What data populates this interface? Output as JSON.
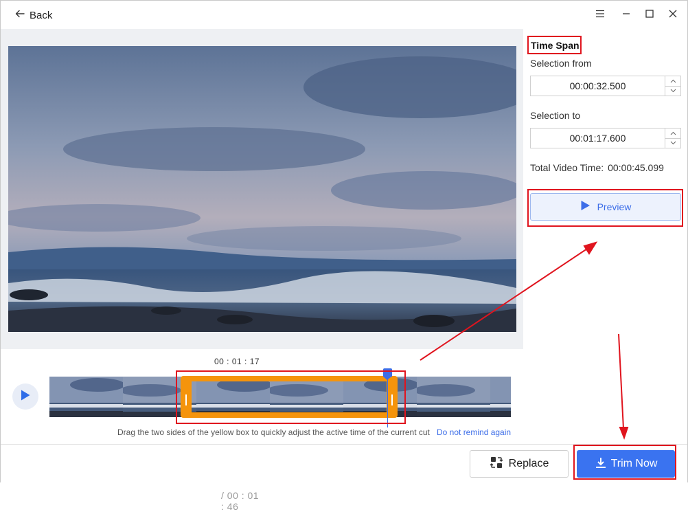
{
  "titlebar": {
    "back_label": "Back",
    "icons": [
      "back-arrow-icon",
      "menu-icon",
      "minimize-icon",
      "maximize-icon",
      "close-icon"
    ]
  },
  "player": {
    "current_time": "00 : 01 : 17",
    "separator": " / ",
    "total_time": "00 : 01 : 46",
    "hint": "Drag the two sides of the yellow box to quickly adjust the active time of the current cut",
    "dont_remind": "Do not remind again"
  },
  "time_span": {
    "title": "Time Span",
    "from_label": "Selection from",
    "from_value": "00:00:32.500",
    "to_label": "Selection to",
    "to_value": "00:01:17.600",
    "total_label": "Total Video Time:",
    "total_value": "00:00:45.099",
    "preview_label": "Preview"
  },
  "footer": {
    "replace_label": "Replace",
    "trim_label": "Trim Now"
  },
  "colors": {
    "accent": "#3a73f0",
    "selection": "#f5940c",
    "annotation": "#e0141e"
  }
}
